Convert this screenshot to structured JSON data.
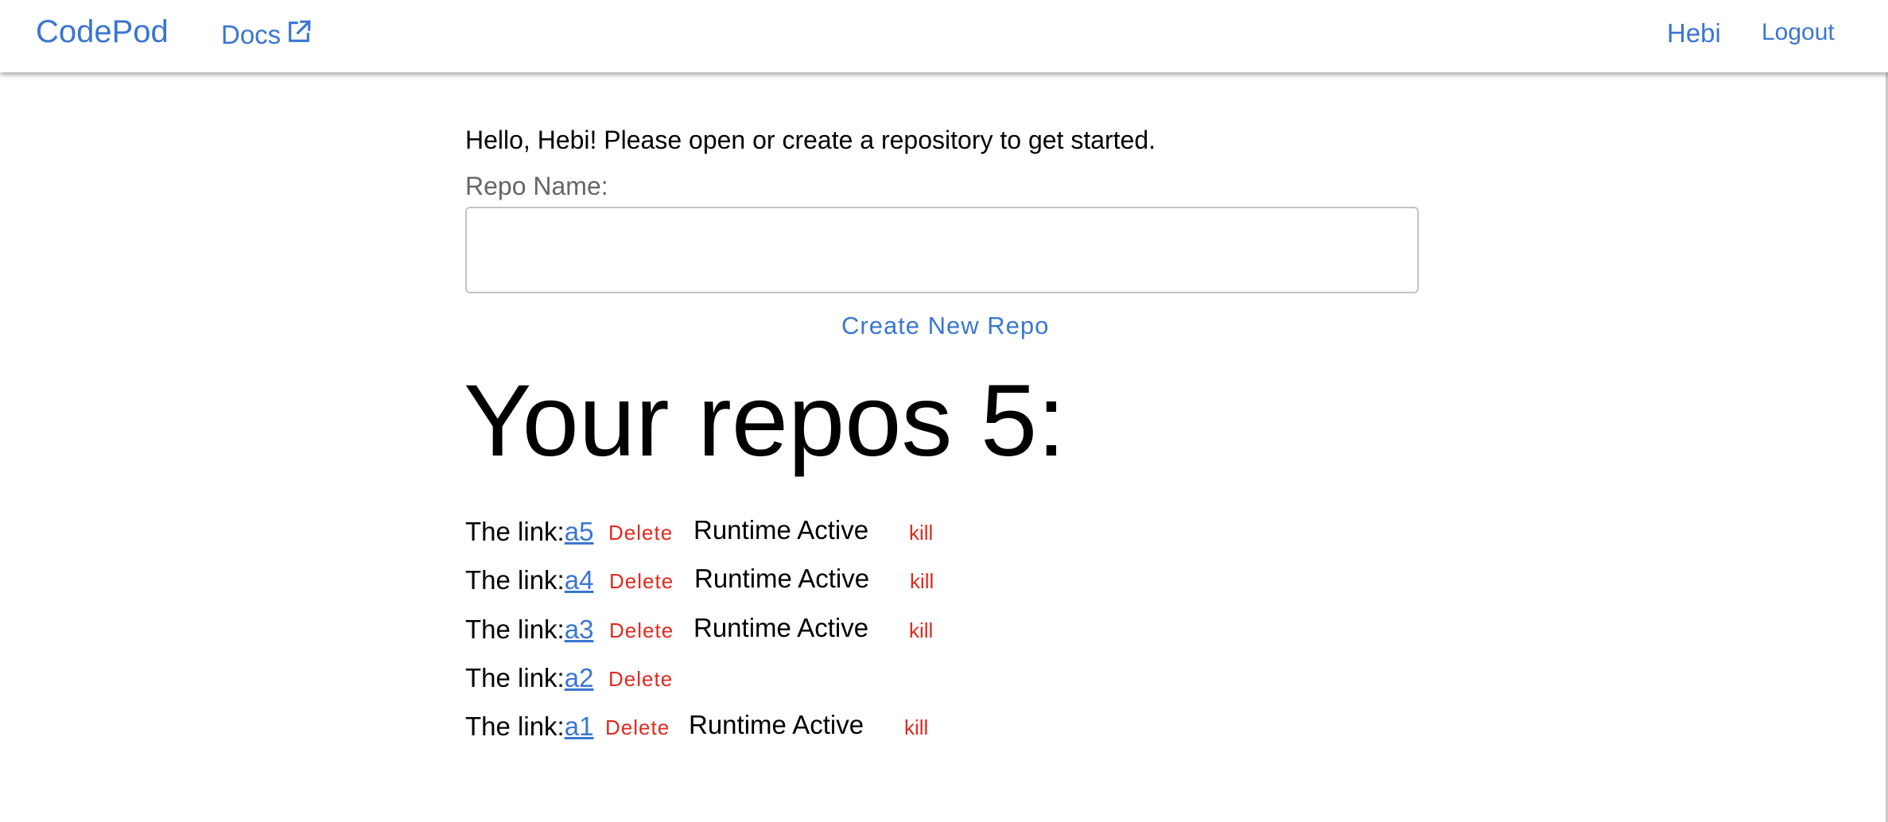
{
  "nav": {
    "brand": "CodePod",
    "docs": "Docs",
    "user": "Hebi",
    "logout": "Logout"
  },
  "main": {
    "greeting": "Hello, Hebi! Please open or create a repository to get started.",
    "repo_label": "Repo Name:",
    "repo_input_value": "",
    "create_button": "Create New Repo",
    "repos_title": "Your repos 5:"
  },
  "repos": [
    {
      "prefix": "The link:",
      "name": "a5",
      "delete": "Delete",
      "runtime": "Runtime Active",
      "kill": "kill"
    },
    {
      "prefix": "The link:",
      "name": "a4",
      "delete": "Delete",
      "runtime": "Runtime Active",
      "kill": "kill"
    },
    {
      "prefix": "The link:",
      "name": "a3",
      "delete": "Delete",
      "runtime": "Runtime Active",
      "kill": "kill"
    },
    {
      "prefix": "The link:",
      "name": "a2",
      "delete": "Delete",
      "runtime": "",
      "kill": ""
    },
    {
      "prefix": "The link:",
      "name": "a1",
      "delete": "Delete",
      "runtime": "Runtime Active",
      "kill": "kill"
    }
  ],
  "colors": {
    "link": "#3a76d2",
    "danger": "#e02a20"
  }
}
